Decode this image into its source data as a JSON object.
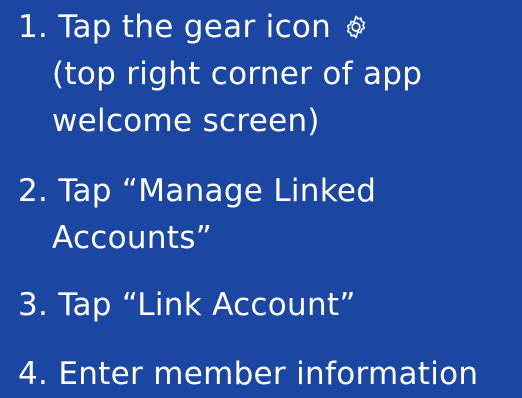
{
  "instructions": {
    "background_color": "#1b47a3",
    "text_color": "#ffffff",
    "steps": [
      {
        "number": "1.",
        "lines": [
          "Tap the gear icon",
          "(top right corner of app",
          "welcome screen)"
        ],
        "icon": "gear-icon"
      },
      {
        "number": "2.",
        "lines": [
          "Tap “Manage Linked",
          "Accounts”"
        ]
      },
      {
        "number": "3.",
        "lines": [
          "Tap “Link Account”"
        ]
      },
      {
        "number": "4.",
        "lines": [
          "Enter member information"
        ]
      }
    ]
  }
}
